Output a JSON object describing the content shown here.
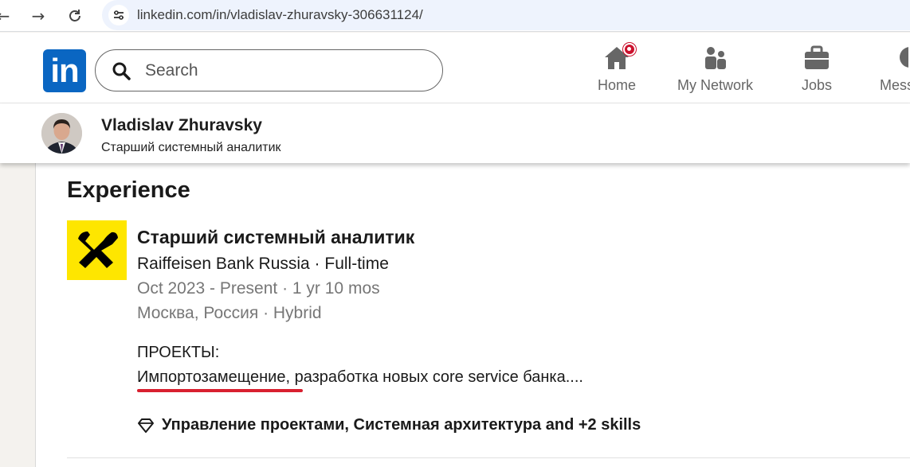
{
  "browser": {
    "url": "linkedin.com/in/vladislav-zhuravsky-306631124/",
    "back_icon": "arrow-left-icon",
    "forward_icon": "arrow-right-icon",
    "reload_icon": "reload-icon"
  },
  "header": {
    "logo_text": "in",
    "search_placeholder": "Search",
    "nav": [
      {
        "label": "Home",
        "icon": "home-icon"
      },
      {
        "label": "My Network",
        "icon": "network-icon"
      },
      {
        "label": "Jobs",
        "icon": "briefcase-icon"
      },
      {
        "label": "Mess",
        "icon": "messaging-icon"
      }
    ]
  },
  "profile_bar": {
    "name": "Vladislav Zhuravsky",
    "headline": "Старший системный аналитик"
  },
  "experience": {
    "section_title": "Experience",
    "job_title": "Старший системный аналитик",
    "company_line": "Raiffeisen Bank Russia · Full-time",
    "dates_line": "Oct 2023 - Present · 1 yr 10 mos",
    "location_line": "Москва, Россия · Hybrid",
    "projects_label": "ПРОЕКТЫ:",
    "description": "Импортозамещение, разработка новых core service банка....",
    "skills": "Управление проектами, Системная архитектура and +2 skills"
  },
  "colors": {
    "linkedin_blue": "#0a66c2",
    "raiffeisen_yellow": "#fee600",
    "notification_red": "#cb112d",
    "annotation_underline": "#d8202f"
  }
}
